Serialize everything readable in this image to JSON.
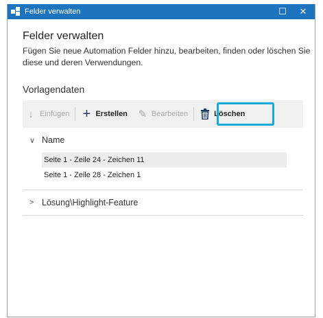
{
  "window": {
    "title": "Felder verwalten",
    "maximize_glyph": "☐",
    "close_glyph": "✕"
  },
  "header": {
    "heading": "Felder verwalten",
    "description": "Fügen Sie neue Automation Felder hinzu, bearbeiten, finden oder löschen Sie diese und deren Verwendungen."
  },
  "section": {
    "title": "Vorlagendaten"
  },
  "toolbar": {
    "insert": {
      "label": "Einfügen",
      "icon": "arrow-down-icon",
      "glyph": "↓",
      "enabled": false
    },
    "create": {
      "label": "Erstellen",
      "icon": "plus-icon",
      "glyph": "+",
      "enabled": true
    },
    "edit": {
      "label": "Bearbeiten",
      "icon": "pencil-icon",
      "glyph": "✎",
      "enabled": false
    },
    "delete": {
      "label": "Löschen",
      "icon": "trash-icon",
      "glyph": "🗑",
      "enabled": true,
      "highlighted": true
    }
  },
  "tree": {
    "groups": [
      {
        "name": "Name",
        "expanded": true,
        "chevron": "∨",
        "items": [
          {
            "label": "Seite 1 - Zeile 24 - Zeichen 11",
            "selected": true
          },
          {
            "label": "Seite 1 - Zeile 28 - Zeichen 1",
            "selected": false
          }
        ]
      },
      {
        "name": "Lösung\\Highlight-Feature",
        "expanded": false,
        "chevron": ">"
      }
    ]
  },
  "colors": {
    "titlebar": "#1e73be",
    "highlight": "#19a9d8",
    "toolbar_bg": "#f0f0f0",
    "selected_row": "#ececec"
  }
}
